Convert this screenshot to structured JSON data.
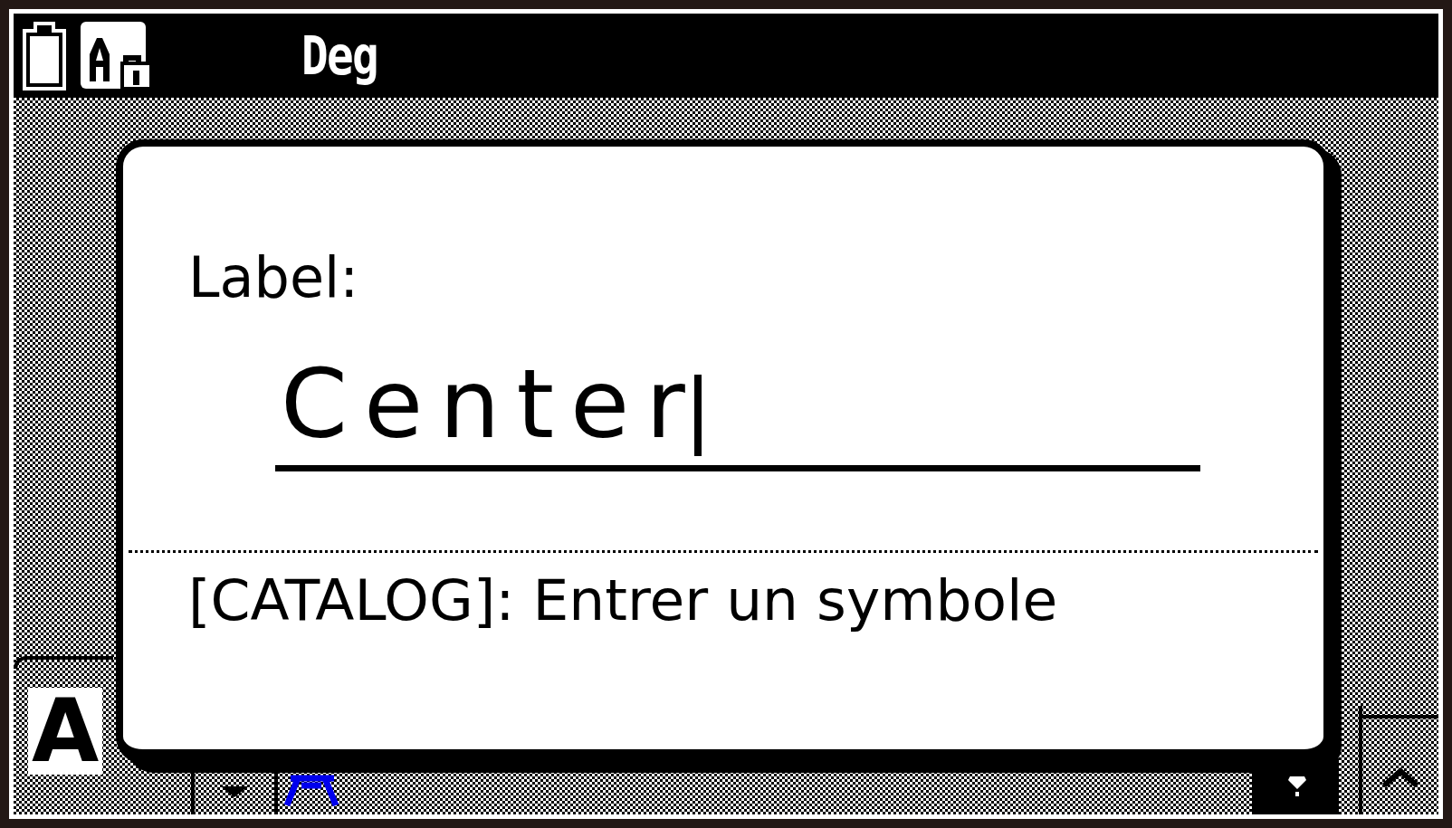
{
  "status_bar": {
    "angle_mode": "Deg"
  },
  "dialog": {
    "label": "Label:",
    "field": {
      "value": "Center",
      "cursor": true
    },
    "hint": "[CATALOG]: Entrer un symbole"
  },
  "background": {
    "letter": "A"
  }
}
